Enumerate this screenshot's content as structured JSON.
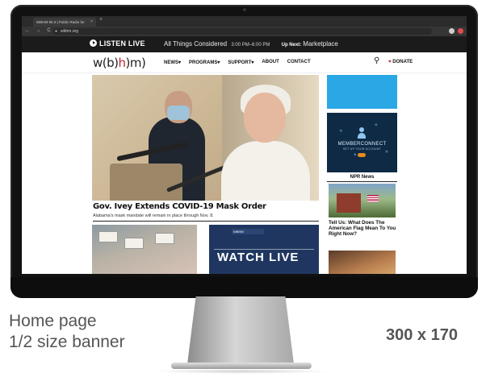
{
  "browser": {
    "tab_title": "WBHM 90.3 | Public Radio for",
    "tab_close": "×",
    "new_tab": "+",
    "nav_glyphs": "← → C ⌂",
    "url": "wbhm.org",
    "extension_colors": [
      "#cfcfcf",
      "#e44b4b"
    ]
  },
  "site": {
    "listen_bar": {
      "listen_label": "LISTEN LIVE",
      "current_show": "All Things Considered",
      "current_time": "3:00 PM–6:00 PM",
      "up_next_label": "Up Next:",
      "up_next_show": "Marketplace"
    },
    "logo": {
      "part1": "w(b)",
      "part2": "h",
      "part3": ")m)"
    },
    "nav": {
      "items": [
        "NEWS",
        "PROGRAMS",
        "SUPPORT",
        "ABOUT",
        "CONTACT"
      ],
      "search_glyph": "🔍",
      "donate_label": "DONATE",
      "accent_color": "#c0262d"
    },
    "hero": {
      "headline": "Gov. Ivey Extends COVID-19 Mask Order",
      "dek": "Alabama's mask mandate will remain in place through Nov. 8."
    },
    "feature2": {
      "strip_text": "WBHM",
      "watch_text": "WATCH LIVE"
    },
    "sidebar": {
      "member_title": "MEMBERCONNECT",
      "member_sub": "SET UP YOUR ACCOUNT",
      "npr_section": "NPR News",
      "npr_headline": "Tell Us: What Does The American Flag Mean To You Right Now?"
    }
  },
  "caption": {
    "line1": "Home page",
    "line2": "1/2 size banner",
    "size": "300 x 170"
  }
}
